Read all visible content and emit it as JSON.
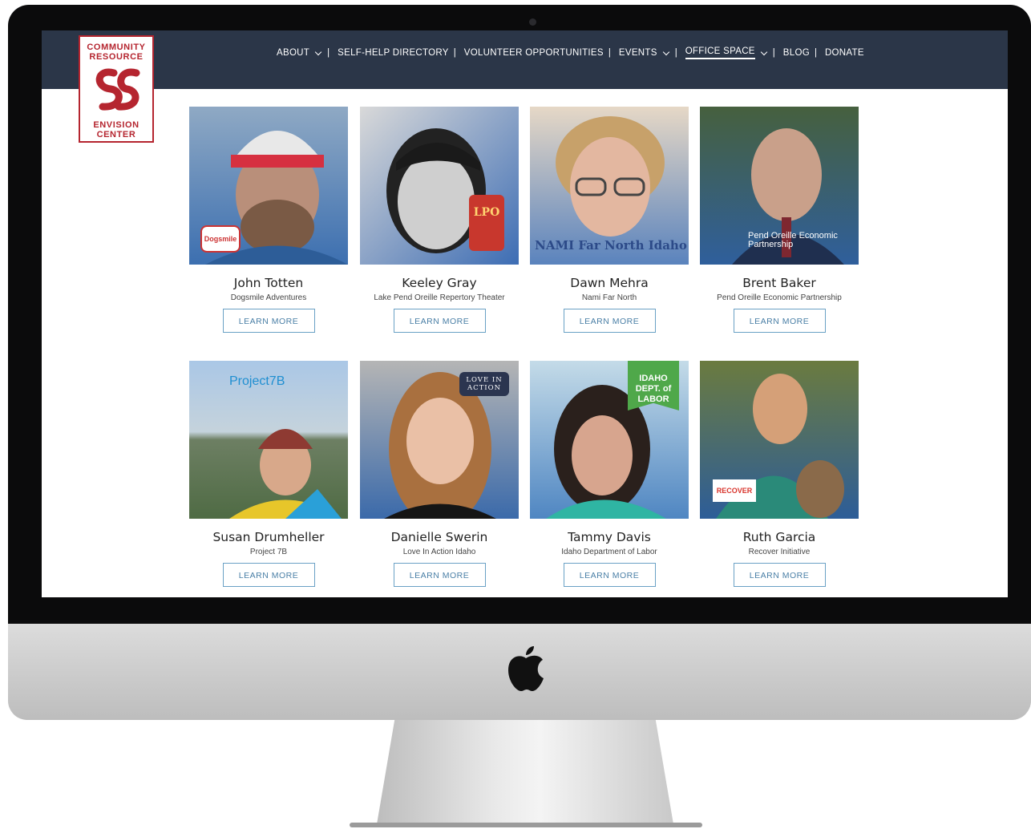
{
  "nav": {
    "items": [
      {
        "label": "ABOUT",
        "dropdown": true,
        "separator": "|"
      },
      {
        "label": "SELF-HELP DIRECTORY",
        "dropdown": false,
        "separator": "|"
      },
      {
        "label": "VOLUNTEER OPPORTUNITIES",
        "dropdown": false,
        "separator": "|"
      },
      {
        "label": "EVENTS",
        "dropdown": true,
        "separator": "|"
      },
      {
        "label": "OFFICE SPACE",
        "dropdown": true,
        "separator": "|"
      },
      {
        "label": "BLOG",
        "dropdown": false,
        "separator": "|"
      },
      {
        "label": "DONATE",
        "dropdown": false,
        "separator": ""
      }
    ],
    "active": "OFFICE SPACE"
  },
  "logo": {
    "top_line1": "COMMUNITY",
    "top_line2": "RESOURCE",
    "bottom_line1": "ENVISION",
    "bottom_line2": "CENTER"
  },
  "people": [
    {
      "name": "John Totten",
      "org": "Dogsmile Adventures",
      "button": "LEARN MORE",
      "badge": "Dogsmile"
    },
    {
      "name": "Keeley Gray",
      "org": "Lake Pend Oreille Repertory Theater",
      "button": "LEARN MORE",
      "badge": "LPO"
    },
    {
      "name": "Dawn Mehra",
      "org": "Nami Far North",
      "button": "LEARN MORE",
      "badge": "NAMI Far North Idaho"
    },
    {
      "name": "Brent Baker",
      "org": "Pend Oreille Economic Partnership",
      "button": "LEARN MORE",
      "badge": "Pend Oreille Economic Partnership"
    },
    {
      "name": "Susan Drumheller",
      "org": "Project 7B",
      "button": "LEARN MORE",
      "badge": "Project7B"
    },
    {
      "name": "Danielle Swerin",
      "org": "Love In Action Idaho",
      "button": "LEARN MORE",
      "badge": "LOVE IN ACTION"
    },
    {
      "name": "Tammy Davis",
      "org": "Idaho Department of Labor",
      "button": "LEARN MORE",
      "badge": "IDAHO DEPT. of LABOR"
    },
    {
      "name": "Ruth Garcia",
      "org": "Recover Initiative",
      "button": "LEARN MORE",
      "badge": "RECOVER"
    }
  ],
  "colors": {
    "nav_bg": "#2b3648",
    "brand_red": "#b5252f",
    "button_border": "#6aa1c5"
  }
}
